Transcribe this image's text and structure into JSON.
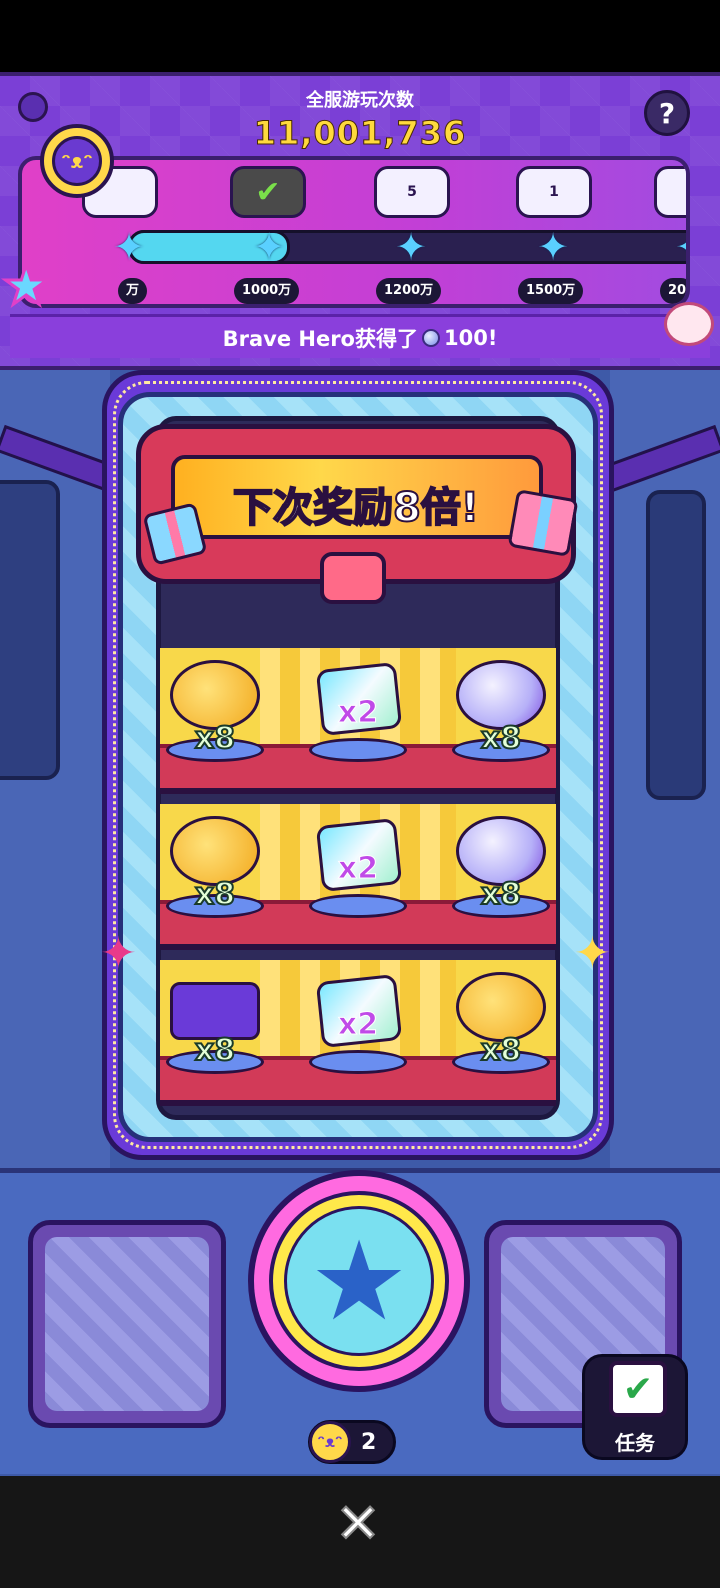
{
  "header": {
    "title": "全服游玩次数",
    "total_plays": "11,001,736",
    "help_label": "?"
  },
  "milestones": [
    {
      "label": "万",
      "reward_badge": ""
    },
    {
      "label": "1000万",
      "reward_badge": ""
    },
    {
      "label": "1200万",
      "reward_badge": "5"
    },
    {
      "label": "1500万",
      "reward_badge": "1"
    },
    {
      "label": "20",
      "reward_badge": ""
    }
  ],
  "progress_fraction": 0.28,
  "broadcast": {
    "prefix": "Brave Hero获得了",
    "amount": "100!"
  },
  "banner": {
    "text": "下次奖励8倍!"
  },
  "shelves": [
    {
      "left": "x8",
      "center": "x2",
      "right": "x8",
      "left_item": "coin-pile",
      "right_item": "gacha-capsule"
    },
    {
      "left": "x8",
      "center": "x2",
      "right": "x8",
      "left_item": "coin-pile",
      "right_item": "gacha-capsule"
    },
    {
      "left": "x8",
      "center": "x2",
      "right": "x8",
      "left_item": "pet-pack",
      "right_item": "coin-pile"
    }
  ],
  "tokens": {
    "count": "2"
  },
  "quest": {
    "label": "任务"
  },
  "close_label": "✕",
  "colors": {
    "panel_purple": "#7b3fd6",
    "count_yellow": "#ffd93d",
    "banner_red": "#d83a5a",
    "progress_cyan": "#54d7f0"
  }
}
